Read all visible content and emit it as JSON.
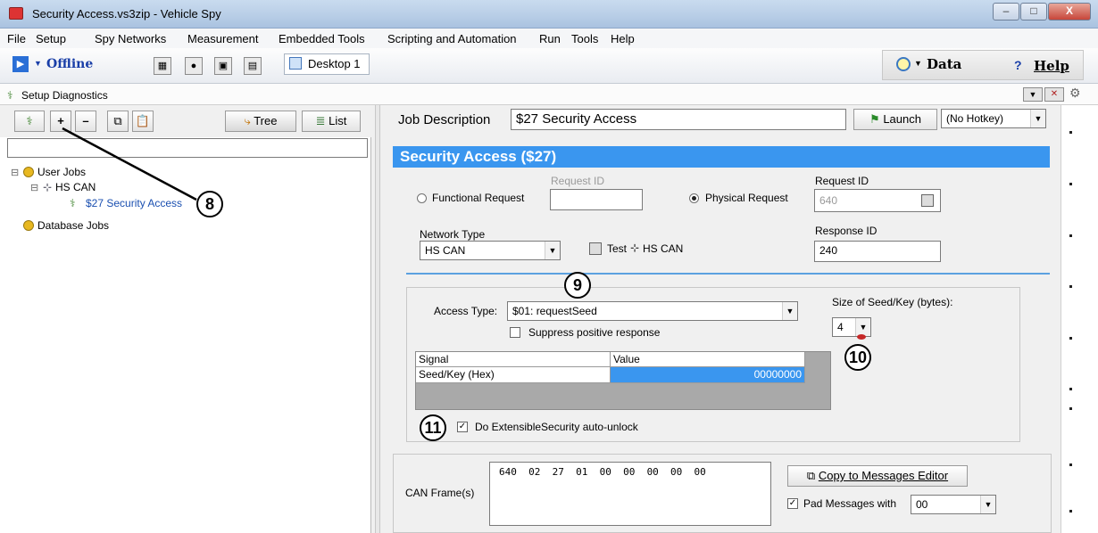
{
  "window": {
    "title": "Security Access.vs3zip - Vehicle Spy",
    "btn_min": "–",
    "btn_max": "□",
    "btn_close": "X"
  },
  "menu": [
    "File",
    "Setup",
    "Spy Networks",
    "Measurement",
    "Embedded Tools",
    "Scripting and Automation",
    "Run",
    "Tools",
    "Help"
  ],
  "toolbar": {
    "status": "Offline",
    "desktop_tab": "Desktop 1",
    "data_label": "Data",
    "help_label": "Help",
    "help_prefix": "?"
  },
  "subbar": {
    "title": "Setup Diagnostics"
  },
  "left": {
    "tree_btn": "Tree",
    "list_btn": "List",
    "plus": "+",
    "minus": "–",
    "tree": {
      "user_jobs": "User Jobs",
      "hs_can": "HS CAN",
      "security": "$27 Security Access",
      "database_jobs": "Database Jobs",
      "expand": "⊟"
    }
  },
  "callouts": {
    "c8": "8",
    "c9": "9",
    "c10": "10",
    "c11": "11"
  },
  "job": {
    "label": "Job Description",
    "value": "$27 Security Access",
    "launch": "Launch",
    "hotkey": "(No Hotkey)"
  },
  "header": "Security Access ($27)",
  "request": {
    "functional": "Functional Request",
    "req_id_label_disabled": "Request ID",
    "physical": "Physical Request",
    "req_id_label": "Request ID",
    "req_id_value": "640",
    "network_label": "Network Type",
    "network_value": "HS CAN",
    "test_label": "Test",
    "test_net": "HS CAN",
    "resp_label": "Response ID",
    "resp_value": "240"
  },
  "access": {
    "type_label": "Access Type:",
    "type_value": "$01: requestSeed",
    "suppress": "Suppress positive response",
    "size_label": "Size of Seed/Key (bytes):",
    "size_value": "4",
    "grid_headers": [
      "Signal",
      "Value"
    ],
    "grid_row": [
      "Seed/Key (Hex)",
      "00000000"
    ],
    "autounlock": "Do ExtensibleSecurity auto-unlock"
  },
  "frames": {
    "label": "CAN Frame(s)",
    "value": "640  02  27  01  00  00  00  00  00",
    "copy_btn": "Copy to Messages Editor",
    "pad_label": "Pad Messages with",
    "pad_value": "00"
  },
  "icons": [
    "app-icon",
    "play-icon",
    "tree-icon",
    "list-icon",
    "gear-icon",
    "database-icon",
    "save-icon",
    "flag-icon",
    "network-icon"
  ]
}
